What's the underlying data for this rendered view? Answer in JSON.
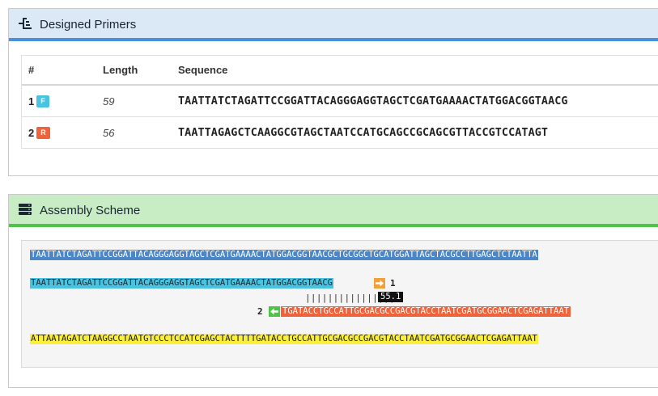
{
  "primers_panel": {
    "title": "Designed Primers",
    "icon": "sitemap-icon",
    "accent": "#4a90d9",
    "columns": [
      "#",
      "Length",
      "Sequence"
    ],
    "rows": [
      {
        "num": "1",
        "badge": "F",
        "length": "59",
        "sequence": "TAATTATCTAGATTCCGGATTACAGGGAGGTAGCTCGATGAAAACTATGGACGGTAACG"
      },
      {
        "num": "2",
        "badge": "R",
        "length": "56",
        "sequence": "TAATTAGAGCTCAAGGCGTAGCTAATCCATGCAGCCGCAGCGTTACCGTCCATAGT"
      }
    ]
  },
  "assembly_panel": {
    "title": "Assembly Scheme",
    "icon": "server-icon",
    "accent": "#4cc445",
    "template_seq": "TAATTATCTAGATTCCGGATTACAGGGAGGTAGCTCGATGAAAACTATGGACGGTAACGCTGCGGCTGCATGGATTAGCTACGCCTTGAGCTCTAATTA",
    "forward_seq": "TAATTATCTAGATTCCGGATTACAGGGAGGTAGCTCGATGAAAACTATGGACGGTAACG",
    "forward_label": "1",
    "overlap_bars": "||||||||||||||||",
    "overlap_tm": "55.1",
    "reverse_label": "2",
    "reverse_seq": "TGATACCTGCCATTGCGACGCCGACGTACCTAATCGATGCGGAACTCGAGATTAAT",
    "product_seq": "ATTAATAGATCTAAGGCCTAATGTCCCTCCATCGAGCTACTTTTGATACCTGCCATTGCGACGCCGACGTACCTAATCGATGCGGAACTCGAGATTAAT"
  }
}
